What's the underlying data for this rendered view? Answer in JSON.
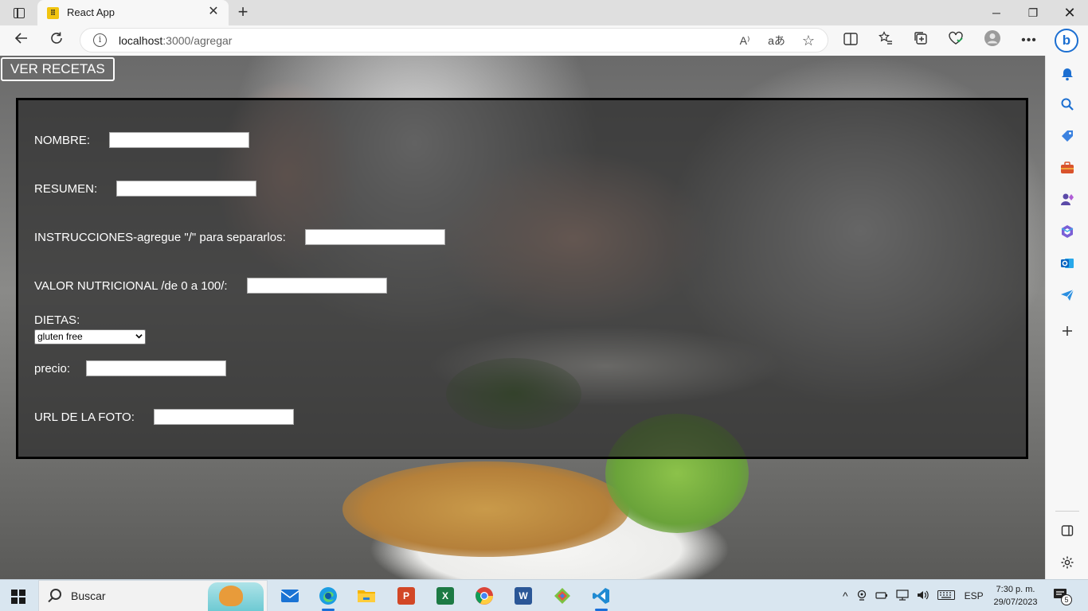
{
  "browser": {
    "tab_title": "React App",
    "favicon_text": "⠿",
    "url_host": "localhost",
    "url_path": ":3000/agregar",
    "read_aloud_label": "A⁾",
    "translate_label": "aあ"
  },
  "page": {
    "ver_recetas_label": "VER RECETAS",
    "form": {
      "nombre_label": "NOMBRE:",
      "resumen_label": "RESUMEN:",
      "instrucciones_label": "INSTRUCCIONES-agregue \"/\" para separarlos:",
      "valor_label": "VALOR NUTRICIONAL /de 0 a 100/:",
      "dietas_label": "DIETAS:",
      "dietas_selected": "gluten free",
      "precio_label": "precio:",
      "foto_label": "URL DE LA FOTO:"
    }
  },
  "taskbar": {
    "search_text": "Buscar",
    "language": "ESP",
    "time": "7:30 p. m.",
    "date": "29/07/2023",
    "notification_count": "5"
  },
  "colors": {
    "edge_blue": "#1c6fd1",
    "form_overlay": "#282828",
    "taskbar_bg": "#d9e6f0"
  }
}
